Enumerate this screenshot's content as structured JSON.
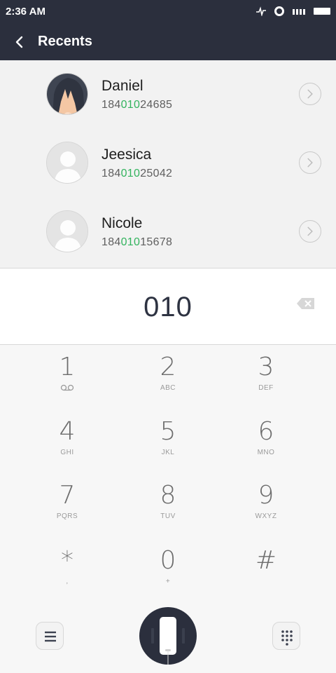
{
  "status_bar": {
    "time": "2:36 AM"
  },
  "header": {
    "title": "Recents"
  },
  "contacts": [
    {
      "name": "Daniel",
      "number_pre": "184",
      "number_match": "010",
      "number_post": "24685",
      "avatar": "photo"
    },
    {
      "name": "Jeesica",
      "number_pre": "184",
      "number_match": "010",
      "number_post": "25042",
      "avatar": "default"
    },
    {
      "name": "Nicole",
      "number_pre": "184",
      "number_match": "010",
      "number_post": "15678",
      "avatar": "default"
    }
  ],
  "dial_input": {
    "value": "010"
  },
  "keypad": [
    {
      "num": "1",
      "sub": "voicemail-icon"
    },
    {
      "num": "2",
      "sub": "ABC"
    },
    {
      "num": "3",
      "sub": "DEF"
    },
    {
      "num": "4",
      "sub": "GHI"
    },
    {
      "num": "5",
      "sub": "JKL"
    },
    {
      "num": "6",
      "sub": "MNO"
    },
    {
      "num": "7",
      "sub": "PQRS"
    },
    {
      "num": "8",
      "sub": "TUV"
    },
    {
      "num": "9",
      "sub": "WXYZ"
    },
    {
      "num": "*",
      "sub": ","
    },
    {
      "num": "0",
      "sub": "+"
    },
    {
      "num": "#",
      "sub": ""
    }
  ],
  "colors": {
    "bar": "#2b2f3d",
    "match": "#33b35e"
  }
}
